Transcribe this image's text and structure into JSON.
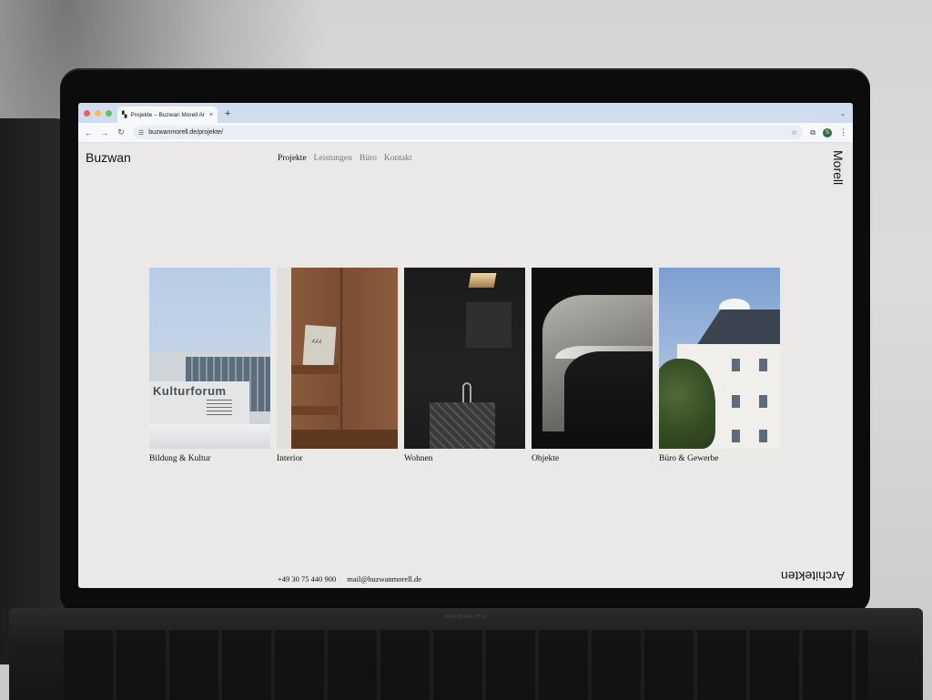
{
  "browser": {
    "tab_title": "Projekte – Buzwan Morell Ar",
    "tab_close": "×",
    "new_tab": "+",
    "tab_menu": "⌄",
    "url": "buzwanmorell.de/projekte/",
    "profile_initial": "S",
    "traffic_colors": [
      "#ee5f57",
      "#f5be4f",
      "#5fc454"
    ]
  },
  "site": {
    "logo_left": "Buzwan",
    "logo_right": "Morell",
    "logo_bottom": "Architekten",
    "nav": [
      {
        "label": "Projekte",
        "active": true
      },
      {
        "label": "Leistungen",
        "active": false
      },
      {
        "label": "Büro",
        "active": false
      },
      {
        "label": "Kontakt",
        "active": false
      }
    ],
    "projects": [
      {
        "caption": "Bildung & Kultur",
        "sign": "Kulturforum"
      },
      {
        "caption": "Interior",
        "book": "ⵃⵃⵃ"
      },
      {
        "caption": "Wohnen"
      },
      {
        "caption": "Objekte"
      },
      {
        "caption": "Büro & Gewerbe"
      }
    ],
    "footer": {
      "phone": "+49 30 75 440 900",
      "email": "mail@buzwanmorell.de"
    }
  },
  "laptop": {
    "brand": "MacBook Pro"
  }
}
